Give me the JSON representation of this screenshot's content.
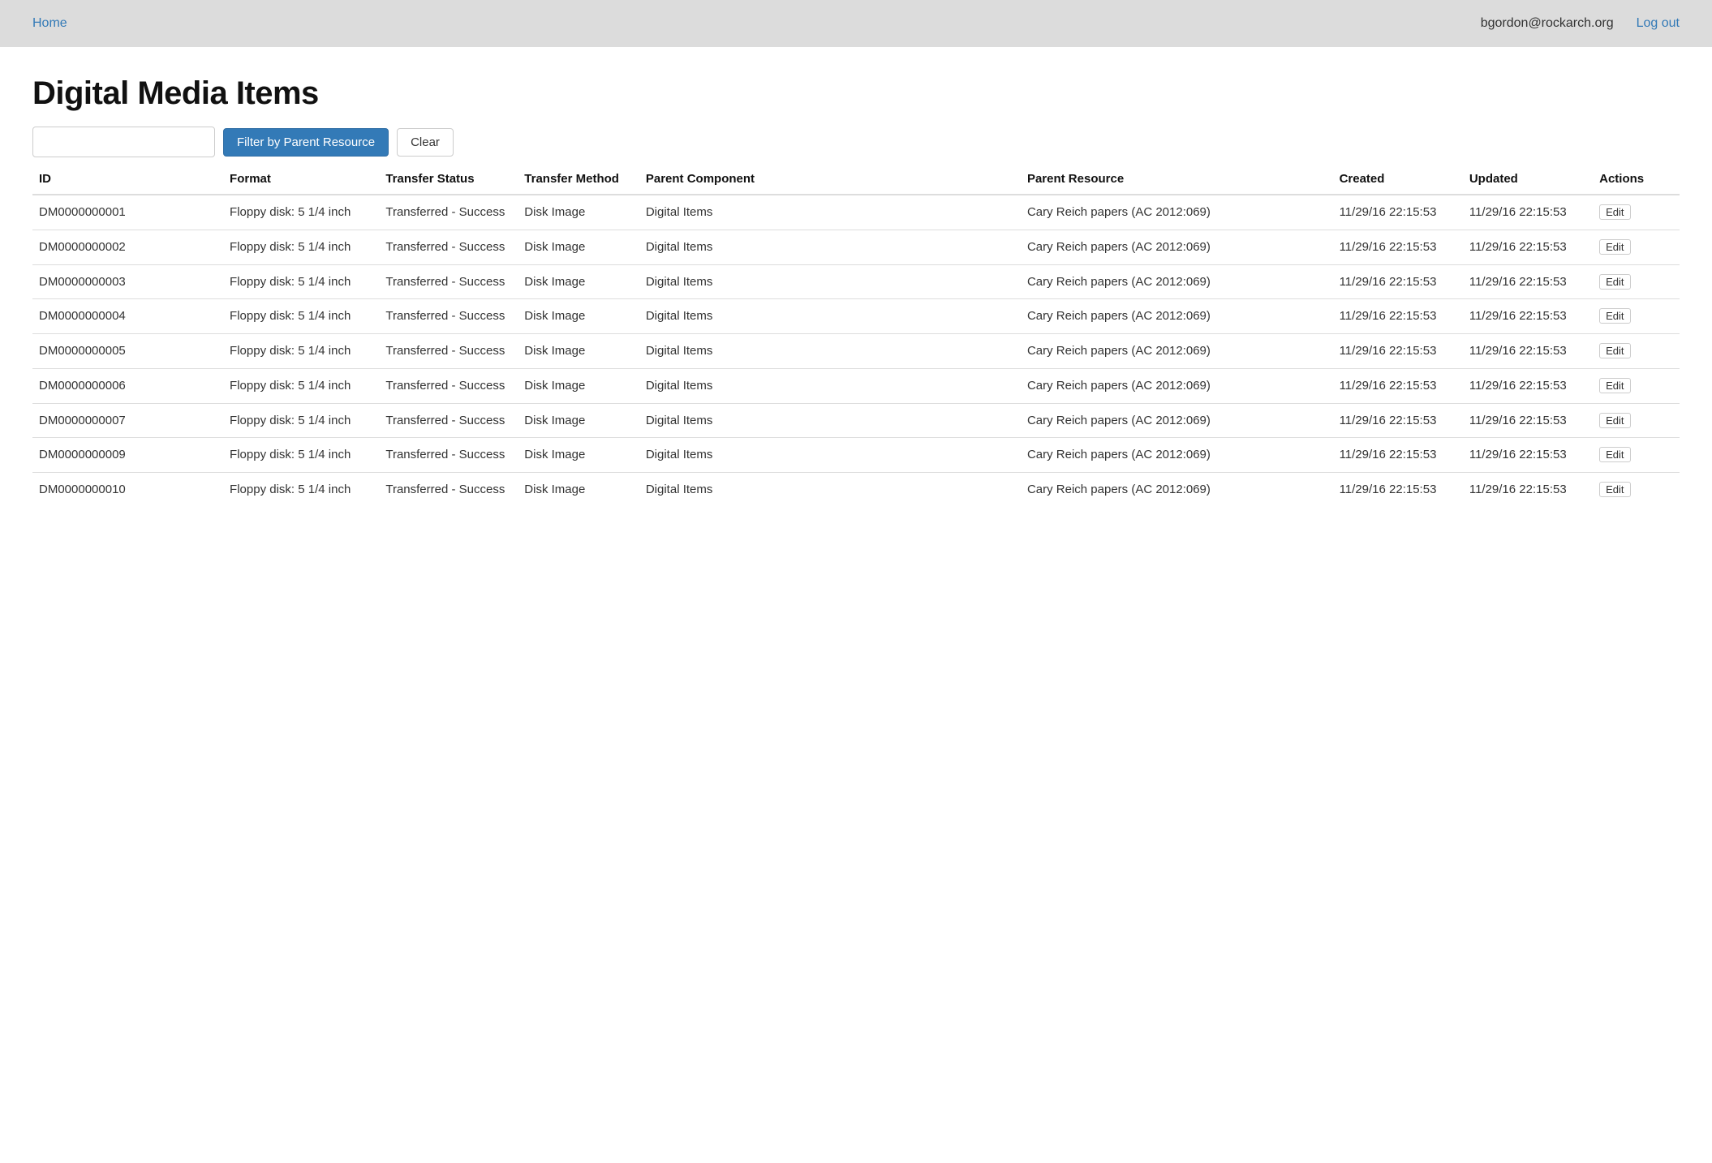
{
  "nav": {
    "home": "Home",
    "user": "bgordon@rockarch.org",
    "logout": "Log out"
  },
  "page": {
    "title": "Digital Media Items"
  },
  "filter": {
    "input_value": "",
    "filter_button": "Filter by Parent Resource",
    "clear_button": "Clear"
  },
  "table": {
    "headers": {
      "id": "ID",
      "format": "Format",
      "transfer_status": "Transfer Status",
      "transfer_method": "Transfer Method",
      "parent_component": "Parent Component",
      "parent_resource": "Parent Resource",
      "created": "Created",
      "updated": "Updated",
      "actions": "Actions"
    },
    "edit_label": "Edit",
    "rows": [
      {
        "id": "DM0000000001",
        "format": "Floppy disk: 5 1/4 inch",
        "status": "Transferred - Success",
        "method": "Disk Image",
        "parent_component": "Digital Items",
        "parent_resource": "Cary Reich papers (AC 2012:069)",
        "created": "11/29/16 22:15:53",
        "updated": "11/29/16 22:15:53"
      },
      {
        "id": "DM0000000002",
        "format": "Floppy disk: 5 1/4 inch",
        "status": "Transferred - Success",
        "method": "Disk Image",
        "parent_component": "Digital Items",
        "parent_resource": "Cary Reich papers (AC 2012:069)",
        "created": "11/29/16 22:15:53",
        "updated": "11/29/16 22:15:53"
      },
      {
        "id": "DM0000000003",
        "format": "Floppy disk: 5 1/4 inch",
        "status": "Transferred - Success",
        "method": "Disk Image",
        "parent_component": "Digital Items",
        "parent_resource": "Cary Reich papers (AC 2012:069)",
        "created": "11/29/16 22:15:53",
        "updated": "11/29/16 22:15:53"
      },
      {
        "id": "DM0000000004",
        "format": "Floppy disk: 5 1/4 inch",
        "status": "Transferred - Success",
        "method": "Disk Image",
        "parent_component": "Digital Items",
        "parent_resource": "Cary Reich papers (AC 2012:069)",
        "created": "11/29/16 22:15:53",
        "updated": "11/29/16 22:15:53"
      },
      {
        "id": "DM0000000005",
        "format": "Floppy disk: 5 1/4 inch",
        "status": "Transferred - Success",
        "method": "Disk Image",
        "parent_component": "Digital Items",
        "parent_resource": "Cary Reich papers (AC 2012:069)",
        "created": "11/29/16 22:15:53",
        "updated": "11/29/16 22:15:53"
      },
      {
        "id": "DM0000000006",
        "format": "Floppy disk: 5 1/4 inch",
        "status": "Transferred - Success",
        "method": "Disk Image",
        "parent_component": "Digital Items",
        "parent_resource": "Cary Reich papers (AC 2012:069)",
        "created": "11/29/16 22:15:53",
        "updated": "11/29/16 22:15:53"
      },
      {
        "id": "DM0000000007",
        "format": "Floppy disk: 5 1/4 inch",
        "status": "Transferred - Success",
        "method": "Disk Image",
        "parent_component": "Digital Items",
        "parent_resource": "Cary Reich papers (AC 2012:069)",
        "created": "11/29/16 22:15:53",
        "updated": "11/29/16 22:15:53"
      },
      {
        "id": "DM0000000009",
        "format": "Floppy disk: 5 1/4 inch",
        "status": "Transferred - Success",
        "method": "Disk Image",
        "parent_component": "Digital Items",
        "parent_resource": "Cary Reich papers (AC 2012:069)",
        "created": "11/29/16 22:15:53",
        "updated": "11/29/16 22:15:53"
      },
      {
        "id": "DM0000000010",
        "format": "Floppy disk: 5 1/4 inch",
        "status": "Transferred - Success",
        "method": "Disk Image",
        "parent_component": "Digital Items",
        "parent_resource": "Cary Reich papers (AC 2012:069)",
        "created": "11/29/16 22:15:53",
        "updated": "11/29/16 22:15:53"
      }
    ]
  }
}
